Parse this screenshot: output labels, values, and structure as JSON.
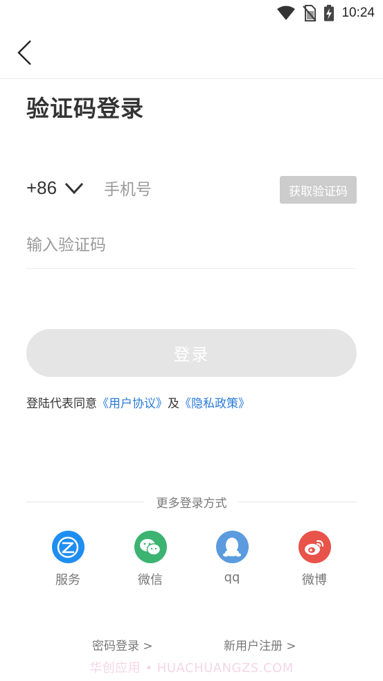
{
  "status_bar": {
    "time": "10:24",
    "icons": [
      "wifi-icon",
      "no-sim-icon",
      "battery-charging-icon"
    ]
  },
  "navbar": {
    "back_icon": "chevron-left-icon"
  },
  "title": "验证码登录",
  "phone": {
    "country_code": "+86",
    "placeholder": "手机号",
    "get_code_label": "获取验证码"
  },
  "code": {
    "placeholder": "输入验证码"
  },
  "login_button": "登录",
  "agreement": {
    "prefix": "登陆代表同意",
    "user_agreement": "《用户协议》",
    "conjunction": "及",
    "privacy_policy": "《隐私政策》"
  },
  "more_login": {
    "title": "更多登录方式",
    "options": [
      {
        "label": "服务",
        "icon": "service-icon",
        "color": "#1f8ef1"
      },
      {
        "label": "微信",
        "icon": "wechat-icon",
        "color": "#3cb371"
      },
      {
        "label": "qq",
        "icon": "qq-icon",
        "color": "#5b9bde"
      },
      {
        "label": "微博",
        "icon": "weibo-icon",
        "color": "#e8534a"
      }
    ]
  },
  "bottom_links": {
    "password_login": "密码登录 >",
    "register": "新用户注册 >"
  },
  "watermark": "华创应用 • HUACHUANGZS.COM"
}
